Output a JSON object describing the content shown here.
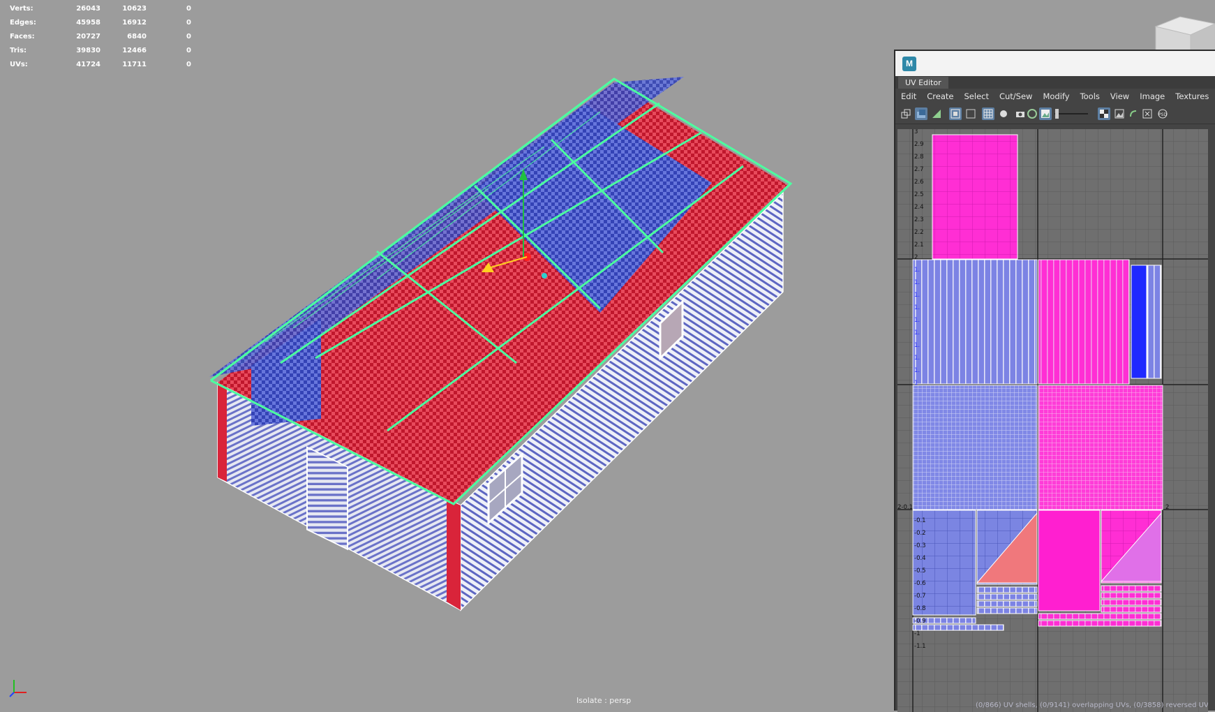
{
  "hud": {
    "rows": [
      {
        "label": "Verts:",
        "v1": "26043",
        "v2": "10623",
        "v3": "0"
      },
      {
        "label": "Edges:",
        "v1": "45958",
        "v2": "16912",
        "v3": "0"
      },
      {
        "label": "Faces:",
        "v1": "20727",
        "v2": "6840",
        "v3": "0"
      },
      {
        "label": "Tris:",
        "v1": "39830",
        "v2": "12466",
        "v3": "0"
      },
      {
        "label": "UVs:",
        "v1": "41724",
        "v2": "11711",
        "v3": "0"
      }
    ]
  },
  "viewport": {
    "camera_label": "Isolate : persp",
    "colors": {
      "background": "#9c9c9c",
      "red": "#d9243a",
      "blue": "#3a4fc8",
      "selection": "#4cffa0"
    }
  },
  "uv_editor": {
    "app_icon_letter": "M",
    "tab_title": "UV Editor",
    "menu": [
      "Edit",
      "Create",
      "Select",
      "Cut/Sew",
      "Modify",
      "Tools",
      "View",
      "Image",
      "Textures"
    ],
    "toolbar_icons": [
      "uv-grid-icon",
      "uv-fill-icon",
      "uv-shell-icon",
      "frame-icon",
      "frame2-icon",
      "grid-toggle-icon",
      "sphere-icon",
      "camera-icon",
      "aperture-icon",
      "image-icon",
      "slider-icon",
      "checker-icon",
      "texture-icon",
      "undo-curve-icon",
      "close-box-icon",
      "psd-icon"
    ],
    "axis_v_labels": [
      "3",
      "2.9",
      "2.8",
      "2.7",
      "2.6",
      "2.5",
      "2.4",
      "2.3",
      "2.2",
      "2.1",
      "2",
      "1.",
      "1.",
      "1.",
      "1.",
      "1.",
      "1.",
      "1.",
      "1.",
      "1.",
      "1",
      "-0.1",
      "-0.2",
      "-0.3",
      "-0.4",
      "-0.5",
      "-0.6",
      "-0.7",
      "-0.8",
      "-0.9",
      "-1",
      "-1.1"
    ],
    "axis_h_left": "2-0.1",
    "axis_h_right": "2",
    "status": "(0/866) UV shells, (0/9141) overlapping UVs, (0/3858) reversed UVs",
    "colors": {
      "magenta": "#ff1fd0",
      "blue_shell": "#7f86e6",
      "deep_blue": "#1f29ff"
    }
  }
}
